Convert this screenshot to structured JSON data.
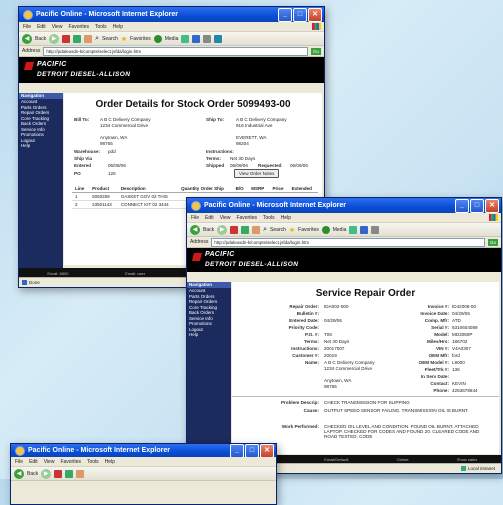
{
  "window1": {
    "title": "Pacific Online - Microsoft Internet Explorer",
    "menu": [
      "File",
      "Edit",
      "View",
      "Favorites",
      "Tools",
      "Help"
    ],
    "toolbar": {
      "back": "Back",
      "search": "Search",
      "favorites": "Favorites",
      "media": "Media"
    },
    "address_label": "Address",
    "address_url": "http://pdaleusdn-k/compts/select.jsfda/login.htm",
    "go": "Go",
    "banner_line1": "PACIFIC",
    "banner_line2": "DETROIT DIESEL-ALLISON",
    "nav_header": "Navigation",
    "nav_items": [
      "Account",
      "Parts Orders",
      "Repair Orders",
      "Core Tracking",
      "Back Orders",
      "Service Info",
      "Promotions",
      "Logout",
      "Help"
    ],
    "page_title": "Order Details for Stock Order 5099493-00",
    "bill_to_label": "Bill To:",
    "bill_to": [
      "A B C Delivery Company",
      "1234 Commercial Drive",
      "",
      "Anytown, WA",
      "98765"
    ],
    "ship_to_label": "Ship To:",
    "ship_to": [
      "A B C Delivery Company",
      "916 Industrial Ave",
      "",
      "EVERETT, WA",
      "98204"
    ],
    "warehouse_label": "Warehouse:",
    "warehouse": "pdd",
    "instructions_label": "Instructions:",
    "ship_via_label": "Ship Via",
    "terms_label": "Terms:",
    "terms": "Net 30 Days",
    "entered_label": "Entered",
    "entered": "06/08/06",
    "shipped_label": "Shipped",
    "shipped": "06/09/06",
    "requested_label": "Requested",
    "requested": "06/09/06",
    "po_label": "PO",
    "po": "126",
    "view_notes": "View Order Notes",
    "lines_headers": [
      "Line",
      "Product",
      "Description",
      "Quantity Order Ship",
      "B/O",
      "MSRP",
      "Price",
      "Extended"
    ],
    "lines": [
      {
        "line": "1",
        "product": "5050259",
        "description": "GASKET GOV 02 THIS"
      },
      {
        "line": "2",
        "product": "23501143",
        "description": "CONNECT KIT 02 3444"
      }
    ],
    "status": "Done",
    "footer": [
      "Email: 8800",
      "Email: user",
      "Email/Quit: 0",
      "Email: 0"
    ]
  },
  "window2": {
    "title": "Pacific Online - Microsoft Internet Explorer",
    "menu": [
      "File",
      "Edit",
      "View",
      "Favorites",
      "Tools",
      "Help"
    ],
    "toolbar": {
      "back": "Back",
      "search": "Search",
      "favorites": "Favorites",
      "media": "Media"
    },
    "address_label": "Address",
    "address_url": "http://pdaleusdn-k/compts/select.jsfda/login.htm",
    "go": "Go",
    "banner_line1": "PACIFIC",
    "banner_line2": "DETROIT DIESEL-ALLISON",
    "nav_header": "Navigation",
    "nav_items": [
      "Account",
      "Parts Orders",
      "Repair Orders",
      "Core Tracking",
      "Back Orders",
      "Service Info",
      "Promotions",
      "Logout",
      "Help"
    ],
    "page_title": "Service Repair Order",
    "left_fields": [
      {
        "label": "Repair Order:",
        "value": "IDA002-000"
      },
      {
        "label": "Bulletin #:",
        "value": ""
      },
      {
        "label": "Entered Date:",
        "value": "04/29/06"
      },
      {
        "label": "Priority Code:",
        "value": ""
      },
      {
        "label": "P.O. #:",
        "value": "T06"
      },
      {
        "label": "Terms:",
        "value": "Net 30 Days"
      },
      {
        "label": "Instructions:",
        "value": "20017007"
      },
      {
        "label": "Customer #:",
        "value": "20019"
      }
    ],
    "right_fields": [
      {
        "label": "Invoice #:",
        "value": "ID42008-00"
      },
      {
        "label": "Invoice Date:",
        "value": "04/29/06"
      },
      {
        "label": "Comp. Mfr:",
        "value": "ATD"
      },
      {
        "label": "Serial #:",
        "value": "6310604089"
      },
      {
        "label": "Model:",
        "value": "MD3060P"
      },
      {
        "label": "Miles/Hrs:",
        "value": "186702"
      },
      {
        "label": "VIN #:",
        "value": "V4A0307"
      },
      {
        "label": "OEM Mfr:",
        "value": "ford"
      },
      {
        "label": "OEM Model #:",
        "value": "L9000"
      },
      {
        "label": "Fleet/Trk #:",
        "value": "136"
      },
      {
        "label": "In Serv Date:",
        "value": ""
      },
      {
        "label": "Contact:",
        "value": "KEVIN"
      },
      {
        "label": "Phone:",
        "value": "4253678644"
      }
    ],
    "name_label": "Name:",
    "name_lines": [
      "A B C Delivery Company",
      "1234 Commercial Drive",
      "",
      "Anytown, WA",
      "98765"
    ],
    "problem_label": "Problem Descrip:",
    "problem": "CHECK TRANSMISSION FOR SLIPPING",
    "cause_label": "Cause:",
    "cause": "OUTPUT SPEED SENSOR FAILING. TRANSMISSION OIL IS BURNT.",
    "work_label": "Work Performed:",
    "work": "CHECKED OIL LEVEL AND CONDITION. FOUND OIL BURNT. ATTACHED LAPTOP. CHECKED FOR CODES AND FOUND 20. CLEARED CODE AND ROAD TESTED. CODE",
    "footer": [
      "Email: 8800",
      "Email/Default:",
      "Online:",
      "Show sales"
    ],
    "status": "Local intranet"
  },
  "window3": {
    "title": "Pacific Online - Microsoft Internet Explorer",
    "menu": [
      "File",
      "Edit",
      "View",
      "Favorites",
      "Tools",
      "Help"
    ],
    "back": "Back"
  }
}
